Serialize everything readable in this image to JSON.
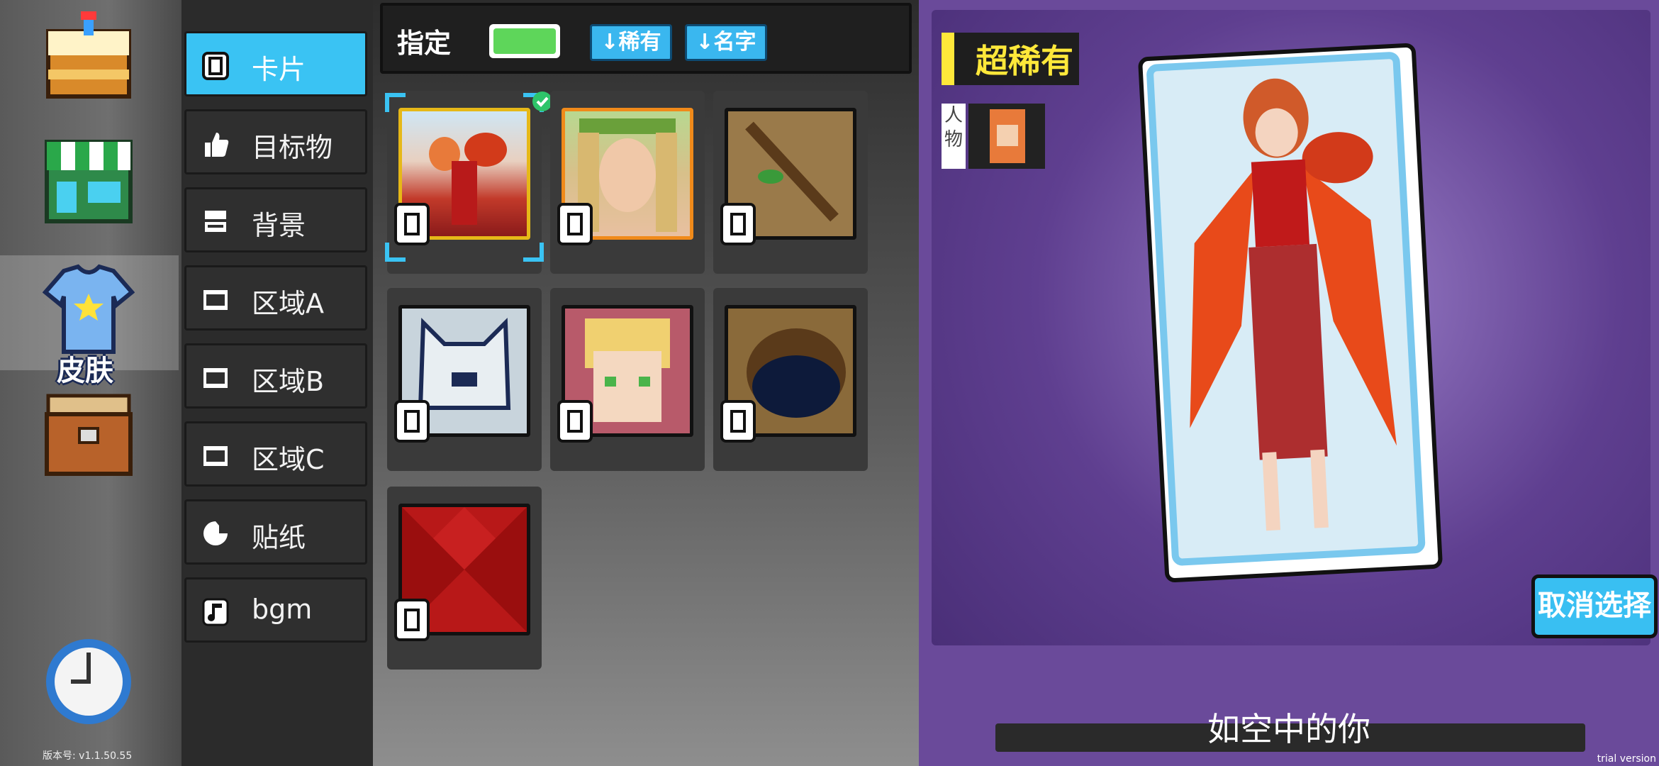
{
  "dock": {
    "selected": "skin",
    "skin_label": "皮肤",
    "version_text": "版本号:   v1.1.50.55"
  },
  "categories": [
    {
      "label": "卡片",
      "icon": "card-icon",
      "active": true
    },
    {
      "label": "目标物",
      "icon": "thumb-icon",
      "active": false
    },
    {
      "label": "背景",
      "icon": "layers-icon",
      "active": false
    },
    {
      "label": "区域A",
      "icon": "film-icon",
      "active": false
    },
    {
      "label": "区域B",
      "icon": "film-icon",
      "active": false
    },
    {
      "label": "区域C",
      "icon": "film-icon",
      "active": false
    },
    {
      "label": "贴纸",
      "icon": "sticker-icon",
      "active": false
    },
    {
      "label": "bgm",
      "icon": "music-icon",
      "active": false
    }
  ],
  "toolbar": {
    "filter_label": "指定",
    "sort_rarity": "↓稀有",
    "sort_name": "↓名字"
  },
  "grid": {
    "items": [
      {
        "name": "phoenix-girl",
        "frame": "#e6b818",
        "selected": true,
        "checked": true
      },
      {
        "name": "laurel-girl",
        "frame": "#f08a1a",
        "selected": false
      },
      {
        "name": "stick",
        "frame": "#111111",
        "selected": false
      },
      {
        "name": "wolf",
        "frame": "#111111",
        "selected": false
      },
      {
        "name": "blonde-girl",
        "frame": "#111111",
        "selected": false
      },
      {
        "name": "pit",
        "frame": "#111111",
        "selected": false
      },
      {
        "name": "red-tile",
        "frame": "#111111",
        "selected": false
      }
    ]
  },
  "preview": {
    "rarity": "超稀有",
    "type_tag": "人物",
    "title": "如空中的你",
    "cancel_label": "取消选择"
  },
  "footer": {
    "trial_text": "trial version"
  },
  "colors": {
    "accent": "#3ac3f3",
    "rarity": "#ffe83a",
    "panel": "#6a4a9a"
  }
}
